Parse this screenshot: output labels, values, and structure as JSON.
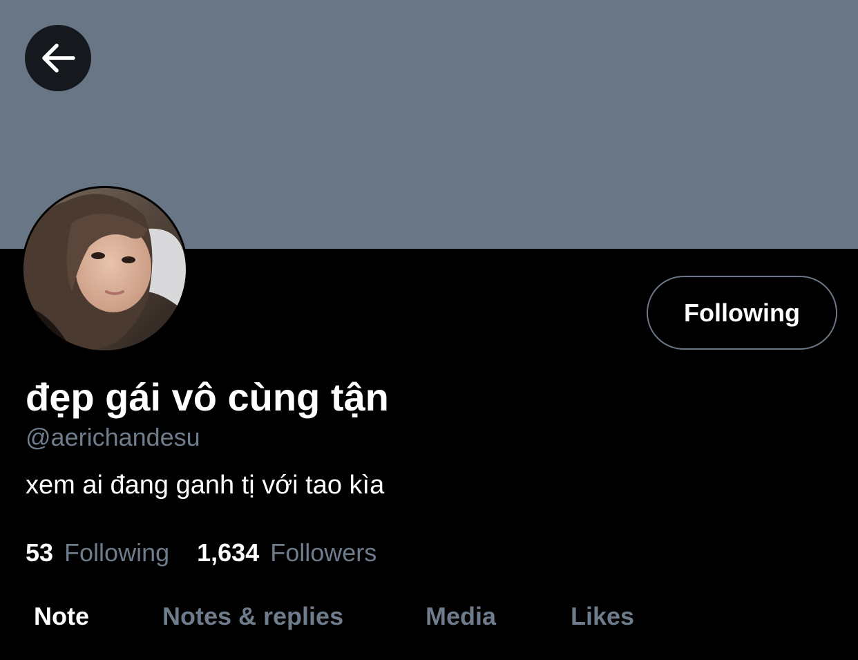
{
  "profile": {
    "display_name": "đẹp gái vô cùng tận",
    "handle": "@aerichandesu",
    "bio": "xem ai đang ganh tị với tao kìa",
    "follow_button_label": "Following"
  },
  "stats": {
    "following_count": "53",
    "following_label": "Following",
    "followers_count": "1,634",
    "followers_label": "Followers"
  },
  "tabs": [
    {
      "label": "Note",
      "active": true
    },
    {
      "label": "Notes & replies",
      "active": false
    },
    {
      "label": "Media",
      "active": false
    },
    {
      "label": "Likes",
      "active": false
    }
  ],
  "icons": {
    "back": "arrow-left-icon"
  },
  "colors": {
    "banner": "#697685",
    "background": "#000000",
    "muted_text": "#6e7c8c",
    "button_border": "#6b7785"
  }
}
